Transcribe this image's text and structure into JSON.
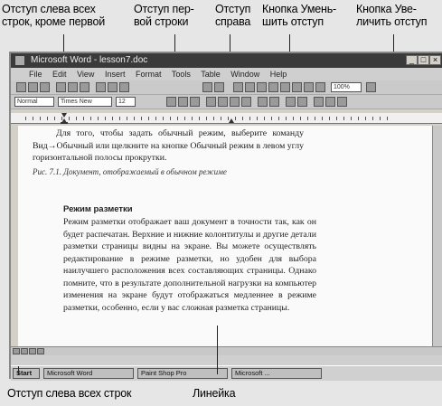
{
  "callouts": {
    "indent_left_except_first": "Отступ слева всех строк, кроме первой",
    "first_line_indent": "Отступ пер- вой строки",
    "indent_right": "Отступ справа",
    "decrease_indent_button": "Кнопка Умень- шить отступ",
    "increase_indent_button": "Кнопка Уве- личить отступ",
    "indent_left_all": "Отступ слева всех строк",
    "ruler": "Линейка"
  },
  "window": {
    "title": "Microsoft Word - lesson7.doc",
    "menu": [
      "File",
      "Edit",
      "View",
      "Insert",
      "Format",
      "Tools",
      "Table",
      "Window",
      "Help"
    ],
    "style_combo": "Normal",
    "font_combo": "Times New Roman",
    "size_combo": "12",
    "zoom_combo": "100%"
  },
  "document": {
    "para1": "Для того, чтобы задать обычный режим, выберите команду Вид→Обычный или щелкните на кнопке Обычный режим в левом углу горизонтальной полосы прокрутки.",
    "caption": "Рис. 7.1. Документ, отображаемый в обычном режиме",
    "heading": "Режим разметки",
    "para2": "Режим разметки отображает ваш документ в точности так, как он будет распечатан. Верхние и нижние колонтитулы и другие детали разметки страницы видны на экране. Вы можете осуществлять редактирование в режиме разметки, но удобен для выбора наилучшего расположения всех составляющих страницы. Однако помните, что в результате дополнительной нагрузки на компьютер изменения на экране будут отображаться медленнее в режиме разметки, особенно, если у вас сложная разметка страницы."
  },
  "taskbar": {
    "items": [
      "Start",
      "Microsoft Word",
      "Paint Shop Pro",
      "Microsoft ..."
    ]
  }
}
